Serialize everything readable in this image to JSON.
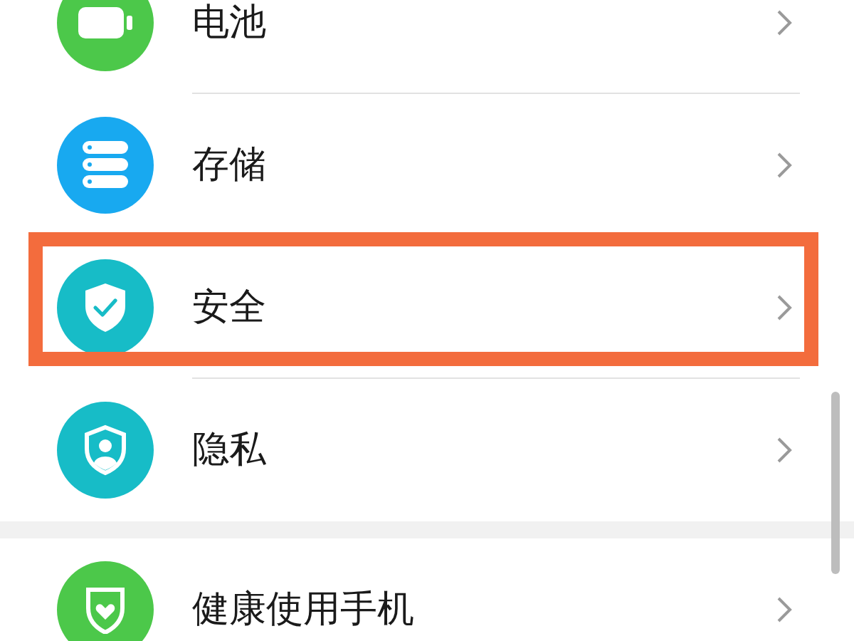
{
  "groups": [
    {
      "items": [
        {
          "label": "电池",
          "kind": "battery",
          "color": "#4cc84a",
          "highlighted": false
        },
        {
          "label": "存储",
          "kind": "storage",
          "color": "#18a9f0",
          "highlighted": false
        },
        {
          "label": "安全",
          "kind": "shield-check",
          "color": "#17bcc7",
          "highlighted": true
        },
        {
          "label": "隐私",
          "kind": "privacy",
          "color": "#17bcc7",
          "highlighted": false
        }
      ]
    },
    {
      "items": [
        {
          "label": "健康使用手机",
          "kind": "health",
          "color": "#4cc84a",
          "highlighted": false
        }
      ]
    }
  ]
}
